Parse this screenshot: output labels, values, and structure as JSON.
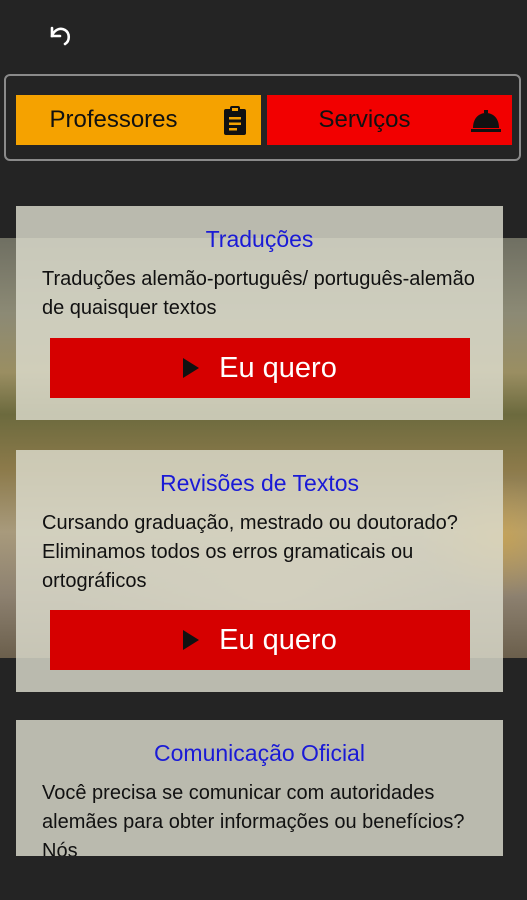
{
  "tabs": {
    "professores_label": "Professores",
    "servicos_label": "Serviços"
  },
  "cards": [
    {
      "title": "Traduções",
      "description": "Traduções alemão-português/ português-alemão de quaisquer textos",
      "cta": "Eu quero"
    },
    {
      "title": "Revisões de Textos",
      "description": "Cursando graduação, mestrado ou doutorado? Eliminamos todos os erros gramaticais ou ortográficos",
      "cta": "Eu quero"
    },
    {
      "title": "Comunicação Oficial",
      "description": "Você precisa se comunicar com autoridades alemães para obter informações ou benefícios? Nós"
    }
  ],
  "colors": {
    "professores_tab": "#f5a200",
    "servicos_tab": "#f20000",
    "cta": "#d60000",
    "title": "#1a1ad6"
  },
  "icons": {
    "back": "undo-icon",
    "professores": "clipboard-icon",
    "servicos": "service-bell-icon"
  }
}
